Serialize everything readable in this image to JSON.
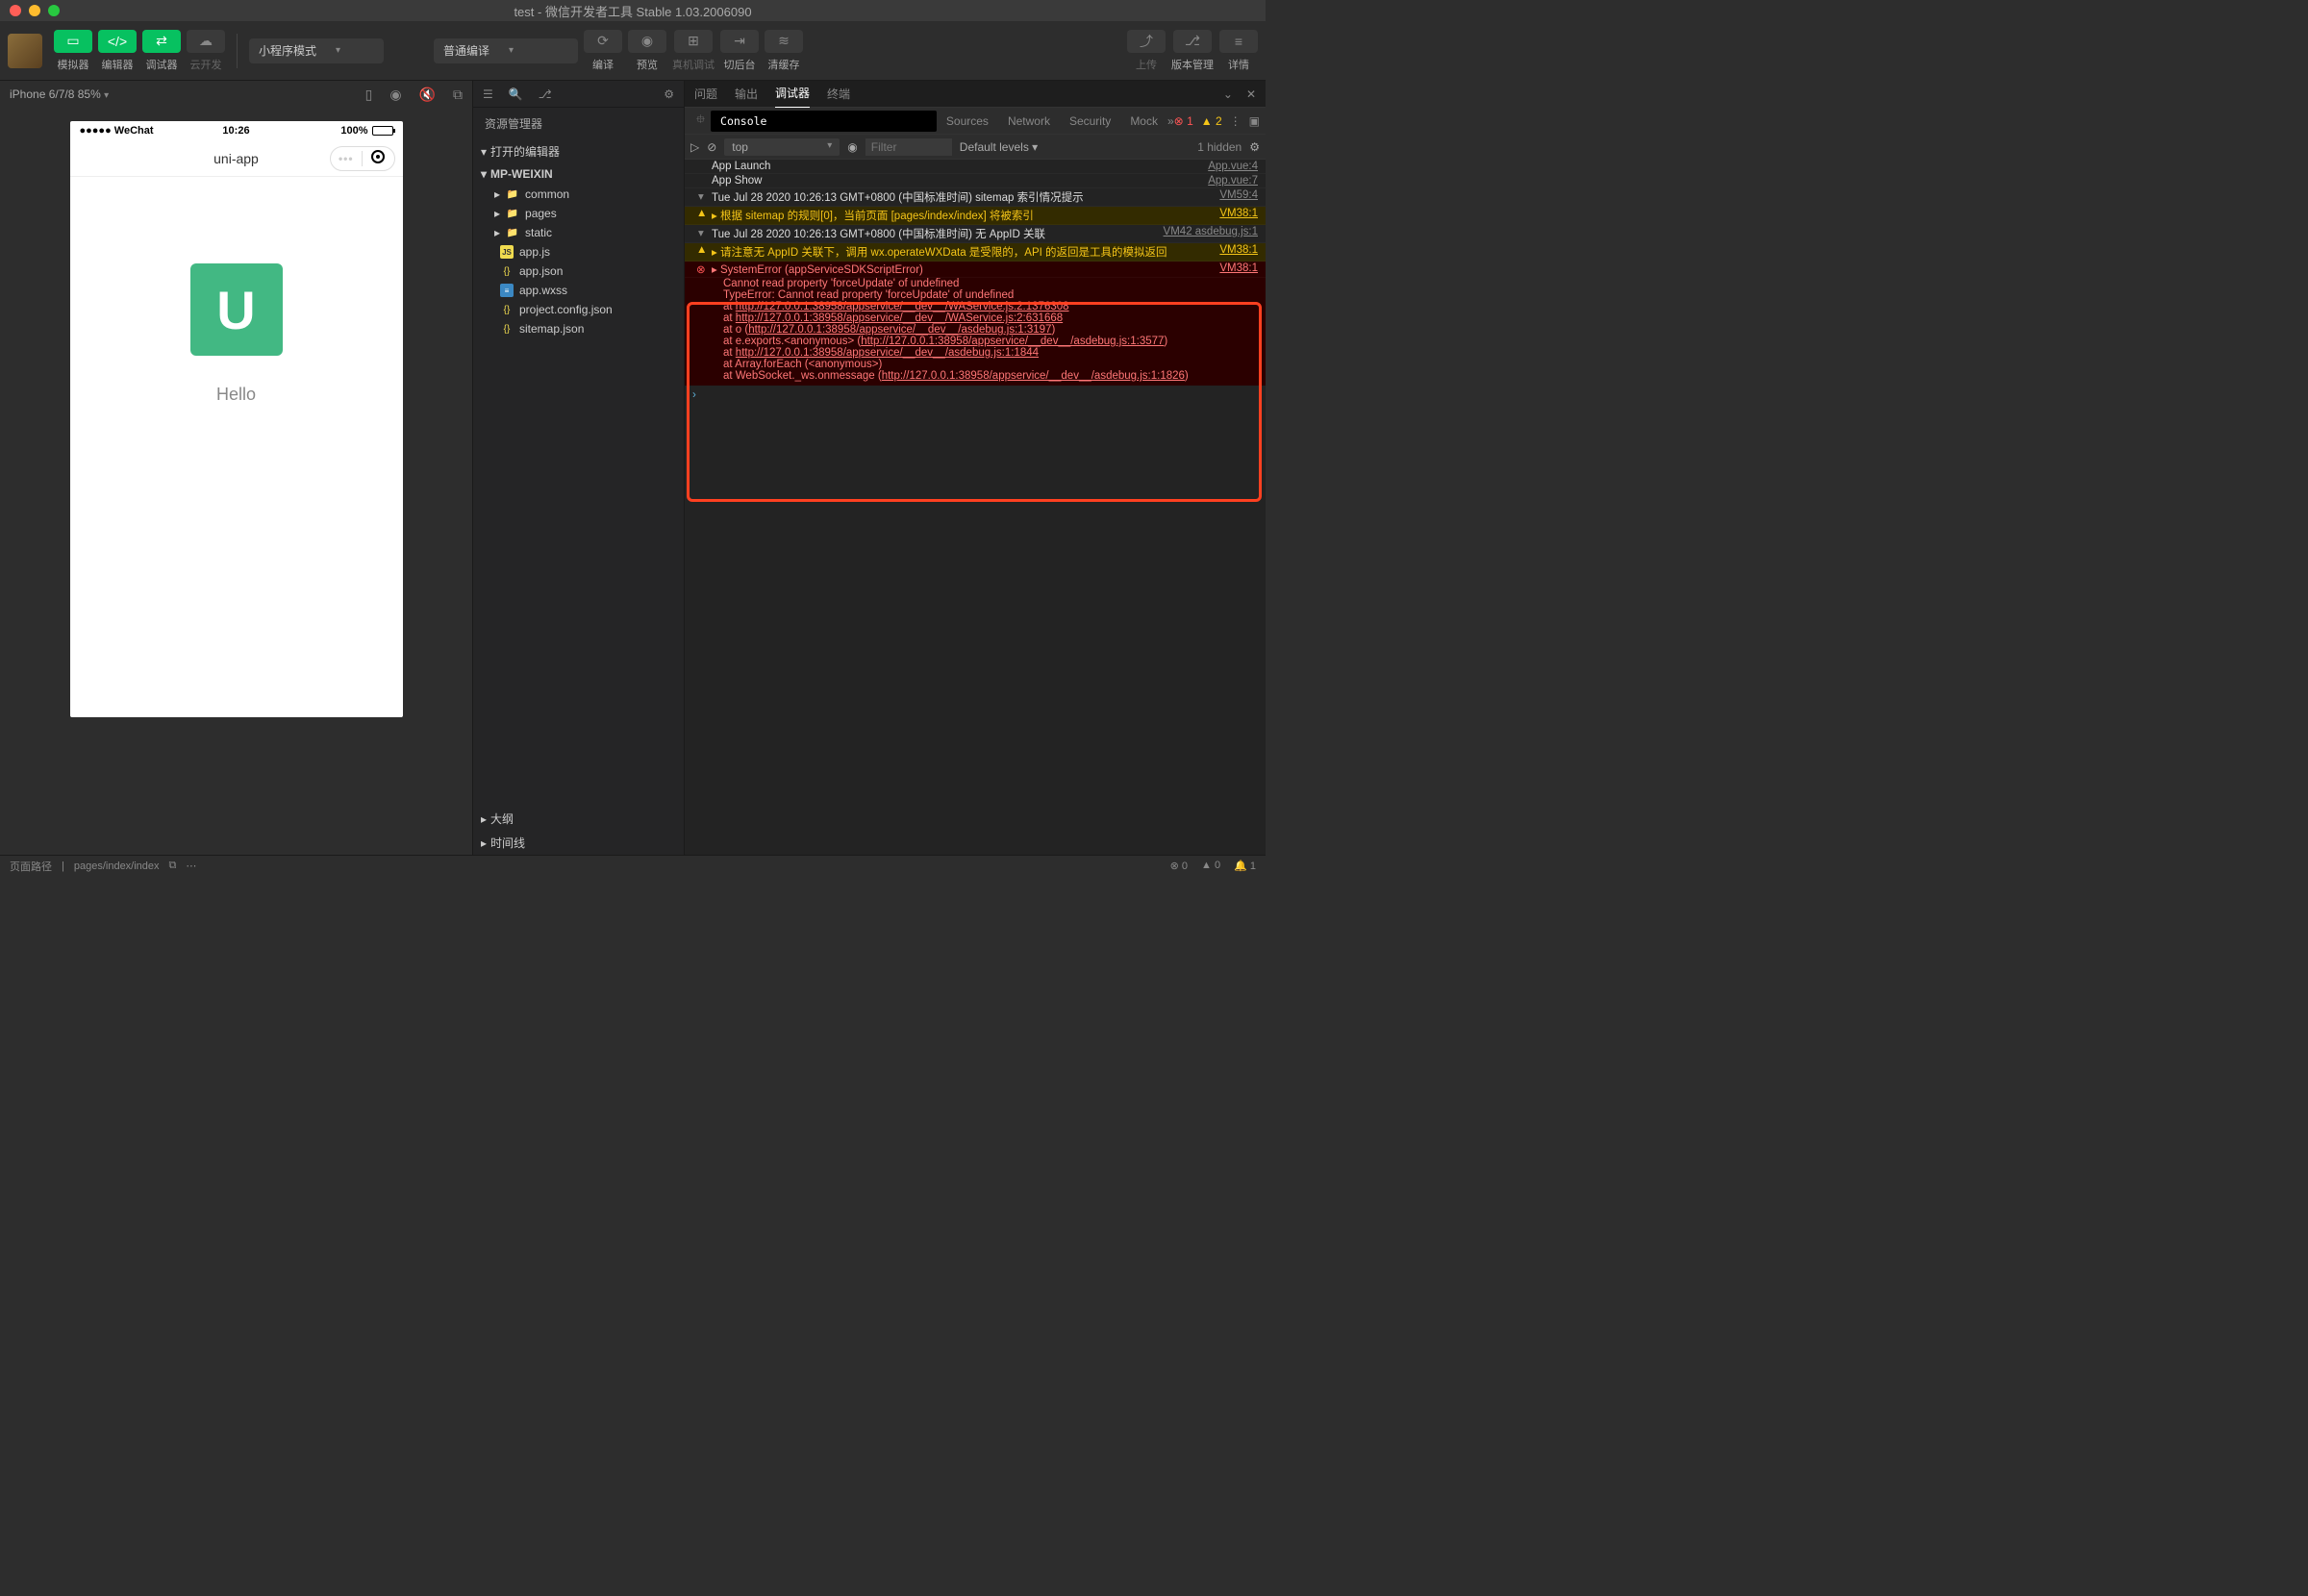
{
  "titlebar": {
    "title": "test - 微信开发者工具 Stable 1.03.2006090"
  },
  "toolbar": {
    "simulator": "模拟器",
    "editor": "编辑器",
    "debugger": "调试器",
    "cloud": "云开发",
    "mode": "小程序模式",
    "compile_mode": "普通编译",
    "compile": "编译",
    "preview": "预览",
    "remote": "真机调试",
    "background": "切后台",
    "cache": "清缓存",
    "upload": "上传",
    "version": "版本管理",
    "detail": "详情"
  },
  "simulator": {
    "device": "iPhone 6/7/8 85%",
    "status_carrier": "WeChat",
    "status_time": "10:26",
    "status_battery": "100%",
    "app_title": "uni-app",
    "hello": "Hello"
  },
  "explorer": {
    "title": "资源管理器",
    "open_editors": "打开的编辑器",
    "project": "MP-WEIXIN",
    "folders": [
      "common",
      "pages",
      "static"
    ],
    "files": [
      "app.js",
      "app.json",
      "app.wxss",
      "project.config.json",
      "sitemap.json"
    ],
    "outline": "大纲",
    "timeline": "时间线"
  },
  "output_tabs": {
    "problems": "问题",
    "output": "输出",
    "debugger": "调试器",
    "terminal": "终端"
  },
  "devtools": {
    "tabs": {
      "console": "Console",
      "sources": "Sources",
      "network": "Network",
      "security": "Security",
      "mock": "Mock"
    },
    "err_count": "1",
    "warn_count": "2",
    "context": "top",
    "filter_ph": "Filter",
    "levels": "Default levels",
    "hidden": "1 hidden"
  },
  "logs": {
    "l1": {
      "msg": "App Launch",
      "src": "App.vue:4"
    },
    "l2": {
      "msg": "App Show",
      "src": "App.vue:7"
    },
    "l3": {
      "msg": "Tue Jul 28 2020 10:26:13 GMT+0800 (中国标准时间) sitemap 索引情况提示",
      "src": "VM59:4"
    },
    "l4": {
      "msg": "根据 sitemap 的规则[0]，当前页面 [pages/index/index] 将被索引",
      "src": "VM38:1"
    },
    "l5": {
      "msg": "Tue Jul 28 2020 10:26:13 GMT+0800 (中国标准时间) 无 AppID 关联",
      "src": "VM42 asdebug.js:1"
    },
    "l6": {
      "msg": "请注意无 AppID 关联下，调用 wx.operateWXData 是受限的，API 的返回是工具的模拟返回",
      "src": "VM38:1"
    },
    "err": {
      "title": "SystemError (appServiceSDKScriptError)",
      "src": "VM38:1",
      "line1": "Cannot read property 'forceUpdate' of undefined",
      "line2": "TypeError: Cannot read property 'forceUpdate' of undefined",
      "s1a": "    at ",
      "s1b": "http://127.0.0.1:38958/appservice/__dev__/WAService.js:2:1376308",
      "s2a": "    at ",
      "s2b": "http://127.0.0.1:38958/appservice/__dev__/WAService.js:2:631668",
      "s3a": "    at o (",
      "s3b": "http://127.0.0.1:38958/appservice/__dev__/asdebug.js:1:3197",
      "s3c": ")",
      "s4a": "    at e.exports.<anonymous> (",
      "s4b": "http://127.0.0.1:38958/appservice/__dev__/asdebug.js:1:3577",
      "s4c": ")",
      "s5a": "    at ",
      "s5b": "http://127.0.0.1:38958/appservice/__dev__/asdebug.js:1:1844",
      "s6": "    at Array.forEach (<anonymous>)",
      "s7a": "    at WebSocket._ws.onmessage (",
      "s7b": "http://127.0.0.1:38958/appservice/__dev__/asdebug.js:1:1826",
      "s7c": ")"
    }
  },
  "statusbar": {
    "path_label": "页面路径",
    "path": "pages/index/index",
    "err": "0",
    "warn": "0",
    "bell": "1"
  }
}
